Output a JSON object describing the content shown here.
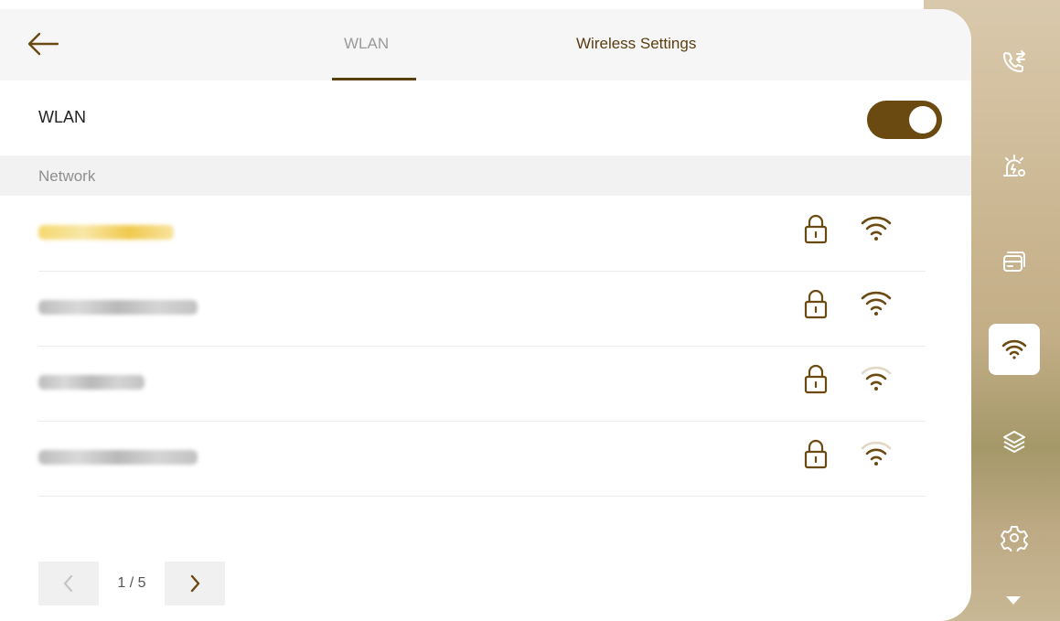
{
  "header": {
    "tabs": [
      {
        "label": "WLAN",
        "active": true
      },
      {
        "label": "Wireless Settings",
        "active": false
      }
    ]
  },
  "wlan": {
    "label": "WLAN",
    "enabled": true
  },
  "section": {
    "title": "Network"
  },
  "networks": [
    {
      "ssid": "",
      "selected": true,
      "secured": true,
      "signal": 3
    },
    {
      "ssid": "",
      "selected": false,
      "secured": true,
      "signal": 3
    },
    {
      "ssid": "",
      "selected": false,
      "secured": true,
      "signal": 2
    },
    {
      "ssid": "",
      "selected": false,
      "secured": true,
      "signal": 2
    }
  ],
  "pager": {
    "text": "1 / 5"
  },
  "sidebar": {
    "items": [
      {
        "icon": "call-transfer-icon",
        "active": false
      },
      {
        "icon": "alarm-settings-icon",
        "active": false
      },
      {
        "icon": "card-icon",
        "active": false
      },
      {
        "icon": "wifi-icon",
        "active": true
      },
      {
        "icon": "layers-icon",
        "active": false
      },
      {
        "icon": "gear-icon",
        "active": false
      }
    ]
  },
  "colors": {
    "accent": "#6b4a12",
    "tab_active_underline": "#5a4010",
    "wifi_strong": "#6b4a12",
    "wifi_weak": "#c9b79a"
  }
}
